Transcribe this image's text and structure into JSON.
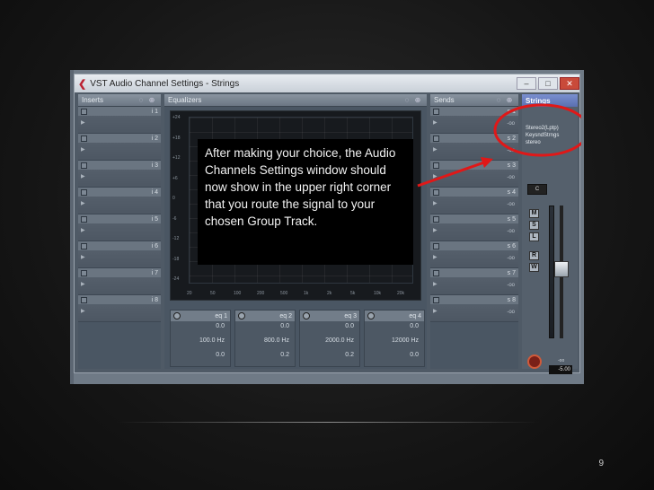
{
  "window": {
    "title": "VST Audio Channel Settings - Strings",
    "minimize": "–",
    "maximize": "□",
    "close": "✕"
  },
  "inserts": {
    "header": "Inserts",
    "slots": [
      "i 1",
      "i 2",
      "i 3",
      "i 4",
      "i 5",
      "i 6",
      "i 7",
      "i 8"
    ]
  },
  "equalizers": {
    "header": "Equalizers",
    "y_ticks": [
      "+24",
      "+18",
      "+12",
      "+6",
      "0",
      "-6",
      "-12",
      "-18",
      "-24"
    ],
    "x_ticks": [
      "20",
      "50",
      "100",
      "200",
      "500",
      "1k",
      "2k",
      "5k",
      "10k",
      "20k"
    ],
    "bands": [
      {
        "label": "eq 1",
        "gain": "0.0",
        "freq": "100.0 Hz",
        "q": "0.0"
      },
      {
        "label": "eq 2",
        "gain": "0.0",
        "freq": "800.0 Hz",
        "q": "0.2"
      },
      {
        "label": "eq 3",
        "gain": "0.0",
        "freq": "2000.0 Hz",
        "q": "0.2"
      },
      {
        "label": "eq 4",
        "gain": "0.0",
        "freq": "12000 Hz",
        "q": "0.0"
      }
    ]
  },
  "sends": {
    "header": "Sends",
    "slots": [
      "s 1",
      "s 2",
      "s 3",
      "s 4",
      "s 5",
      "s 6",
      "s 7",
      "s 8"
    ],
    "level": "-oo"
  },
  "channel_strip": {
    "name": "Strings",
    "routing_output": "Stereo2(Lptp)",
    "routing_group": "KeysndStrngs",
    "routing_mode": "stereo",
    "pan": "C",
    "buttons": [
      "M",
      "S",
      "L",
      "R",
      "W"
    ],
    "volume": "-5.00",
    "peak": "-oo"
  },
  "callout": {
    "text": "After making your choice, the Audio Channels Settings window should now show in the upper right corner that you route the signal to your chosen Group Track."
  },
  "slide": {
    "page_number": "9"
  }
}
